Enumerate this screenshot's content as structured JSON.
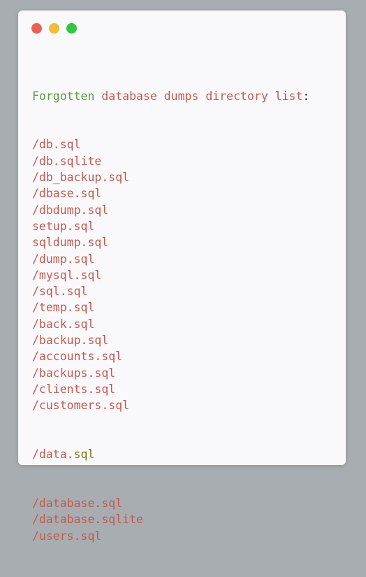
{
  "heading": {
    "word1": "Forgotten",
    "rest": " database dumps directory list",
    "colon": ":"
  },
  "files": [
    "/db.sql",
    "/db.sqlite",
    "/db_backup.sql",
    "/dbase.sql",
    "/dbdump.sql",
    "setup.sql",
    "sqldump.sql",
    "/dump.sql",
    "/mysql.sql",
    "/sql.sql",
    "/temp.sql",
    "/back.sql",
    "/backup.sql",
    "/accounts.sql",
    "/backups.sql",
    "/clients.sql",
    "/customers.sql"
  ],
  "data_line": {
    "prefix": "/data.",
    "ext": "sql"
  },
  "files_after": [
    "/database.sql",
    "/database.sqlite",
    "/users.sql"
  ],
  "colors": {
    "background": "#a7adb0",
    "window": "#f9f9fb",
    "text": "#c75a4e",
    "keyword": "#5c9b3a",
    "close": "#ee5e57",
    "minimize": "#f4bc2f",
    "maximize": "#2fc840"
  }
}
